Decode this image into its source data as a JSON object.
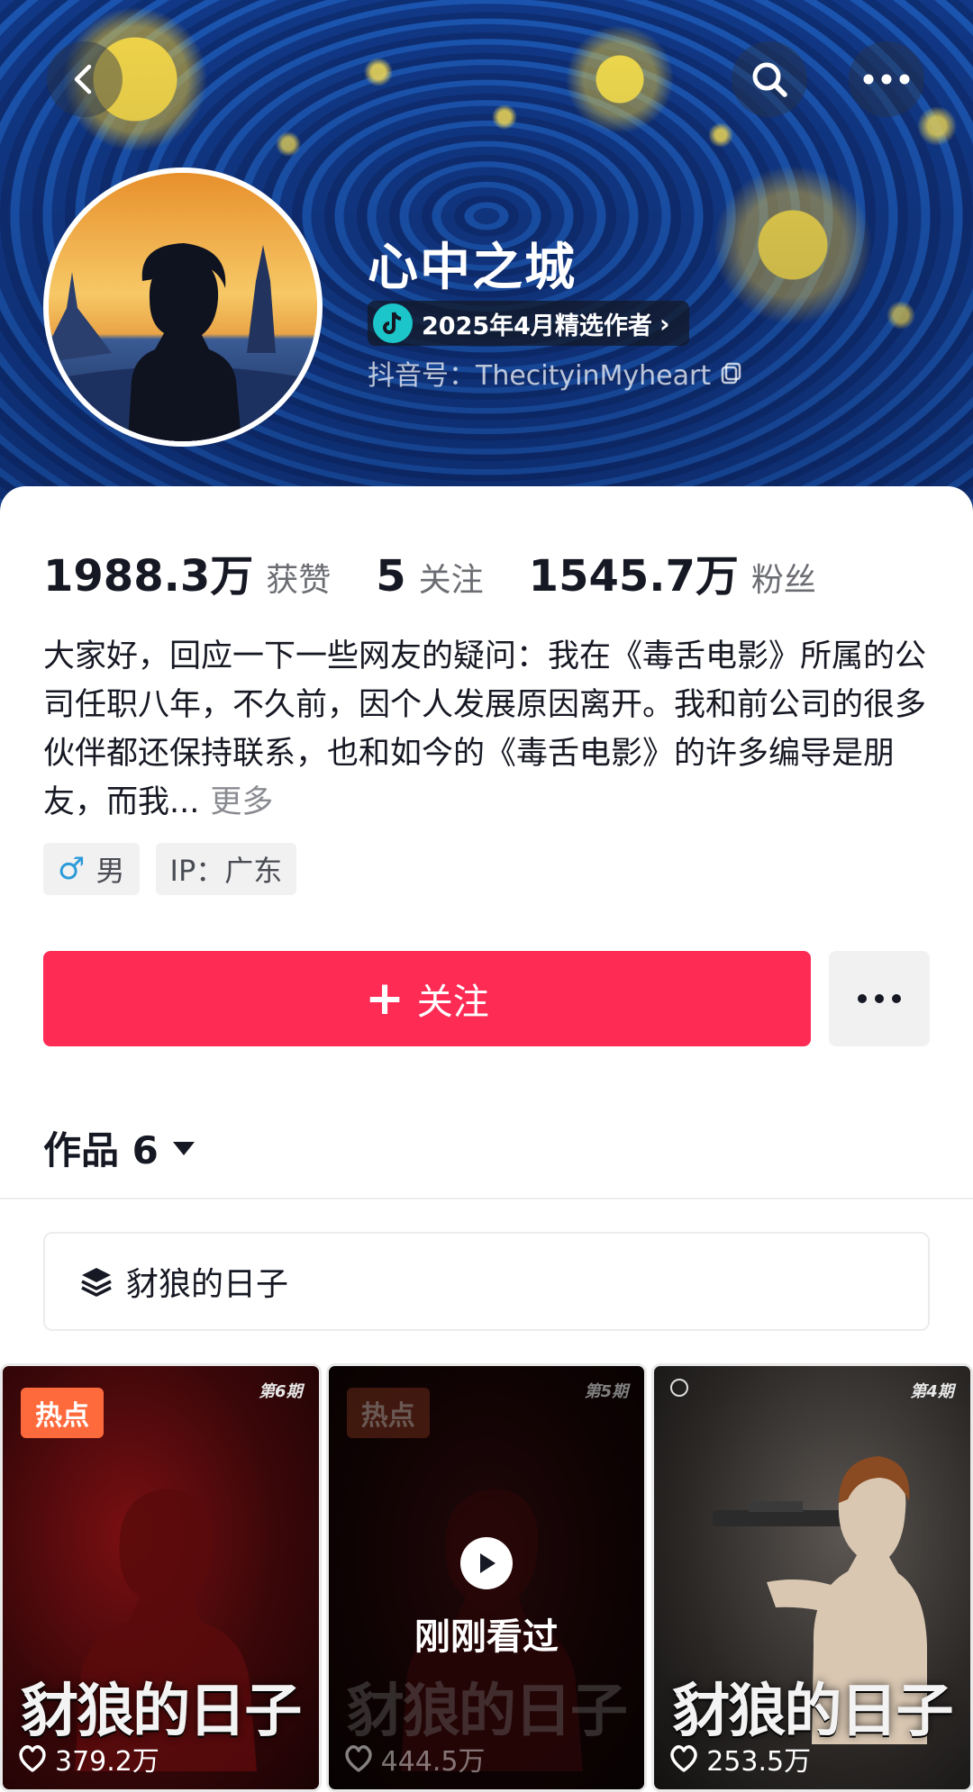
{
  "profile": {
    "name": "心中之城",
    "badge": "2025年4月精选作者",
    "douyin_id": "抖音号：ThecityinMyheart"
  },
  "stats": {
    "likes_num": "1988.3万",
    "likes_label": "获赞",
    "following_num": "5",
    "following_label": "关注",
    "followers_num": "1545.7万",
    "followers_label": "粉丝"
  },
  "bio": {
    "text": "大家好，回应一下一些网友的疑问：我在《毒舌电影》所属的公司任职八年，不久前，因个人发展原因离开。我和前公司的很多伙伴都还保持联系，也和如今的《毒舌电影》的许多编导是朋友，而我...",
    "more": "更多"
  },
  "tags": {
    "gender": "男",
    "ip": "IP：广东"
  },
  "actions": {
    "follow": "关注"
  },
  "works": {
    "title": "作品 6",
    "collection": "豺狼的日子"
  },
  "videos": [
    {
      "badge": "热点",
      "episode": "第6期",
      "title": "豺狼的日子",
      "likes": "379.2万"
    },
    {
      "badge": "热点",
      "episode": "第5期",
      "title": "豺狼的日子",
      "likes": "444.5万",
      "watched": "刚刚看过"
    },
    {
      "episode": "第4期",
      "title": "豺狼的日子",
      "likes": "253.5万"
    }
  ],
  "colors": {
    "accent": "#fe2c55",
    "hot_badge": "#ff6a3d",
    "badge_icon": "#1bc5c9"
  }
}
